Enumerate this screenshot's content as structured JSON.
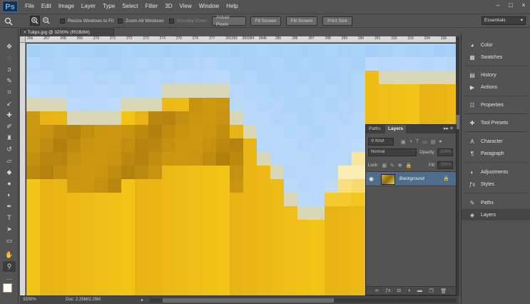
{
  "app": {
    "logo": "Ps"
  },
  "menu": [
    "File",
    "Edit",
    "Image",
    "Layer",
    "Type",
    "Select",
    "Filter",
    "3D",
    "View",
    "Window",
    "Help"
  ],
  "window_controls": {
    "minimize": "–",
    "maximize": "□",
    "close": "×"
  },
  "options_bar": {
    "tool_icon": "zoom-icon",
    "resize_windows": "Resize Windows to Fit",
    "zoom_all_windows": "Zoom All Windows",
    "scrubby_zoom": "Scrubby Zoom",
    "actual_pixels": "Actual Pixels",
    "fit_screen": "Fit Screen",
    "fill_screen": "Fill Screen",
    "print_size": "Print Size",
    "workspace": "Essentials"
  },
  "document": {
    "tab_title": "Tulips.jpg @ 3200% (RGB/8#)",
    "ruler_ticks": [
      "266",
      "267",
      "268",
      "269",
      "270",
      "271",
      "272",
      "273",
      "274",
      "275",
      "276",
      "277",
      "281282",
      "283284",
      "2846",
      "285",
      "286",
      "287",
      "288",
      "289",
      "290",
      "291",
      "332",
      "333",
      "334",
      "335"
    ],
    "zoom": "3200%",
    "doc_size": "Doc: 2.25M/2.25M",
    "colors": {
      "sky": "#a6d0f8",
      "petal": "#f2c418",
      "petal_dark": "#c89612",
      "highlight": "#fffbea"
    }
  },
  "layers_panel": {
    "tabs": [
      "Paths",
      "Layers"
    ],
    "active_tab": "Layers",
    "filter_kind": "Kind",
    "blend_mode": "Normal",
    "opacity_label": "Opacity:",
    "opacity_value": "100%",
    "lock_label": "Lock:",
    "fill_label": "Fill:",
    "fill_value": "100%",
    "layer_name": "Background"
  },
  "dock": {
    "items": [
      "Color",
      "Swatches",
      "History",
      "Actions",
      "Properties",
      "Tool Presets",
      "Character",
      "Paragraph",
      "Adjustments",
      "Styles",
      "Paths",
      "Layers"
    ]
  }
}
